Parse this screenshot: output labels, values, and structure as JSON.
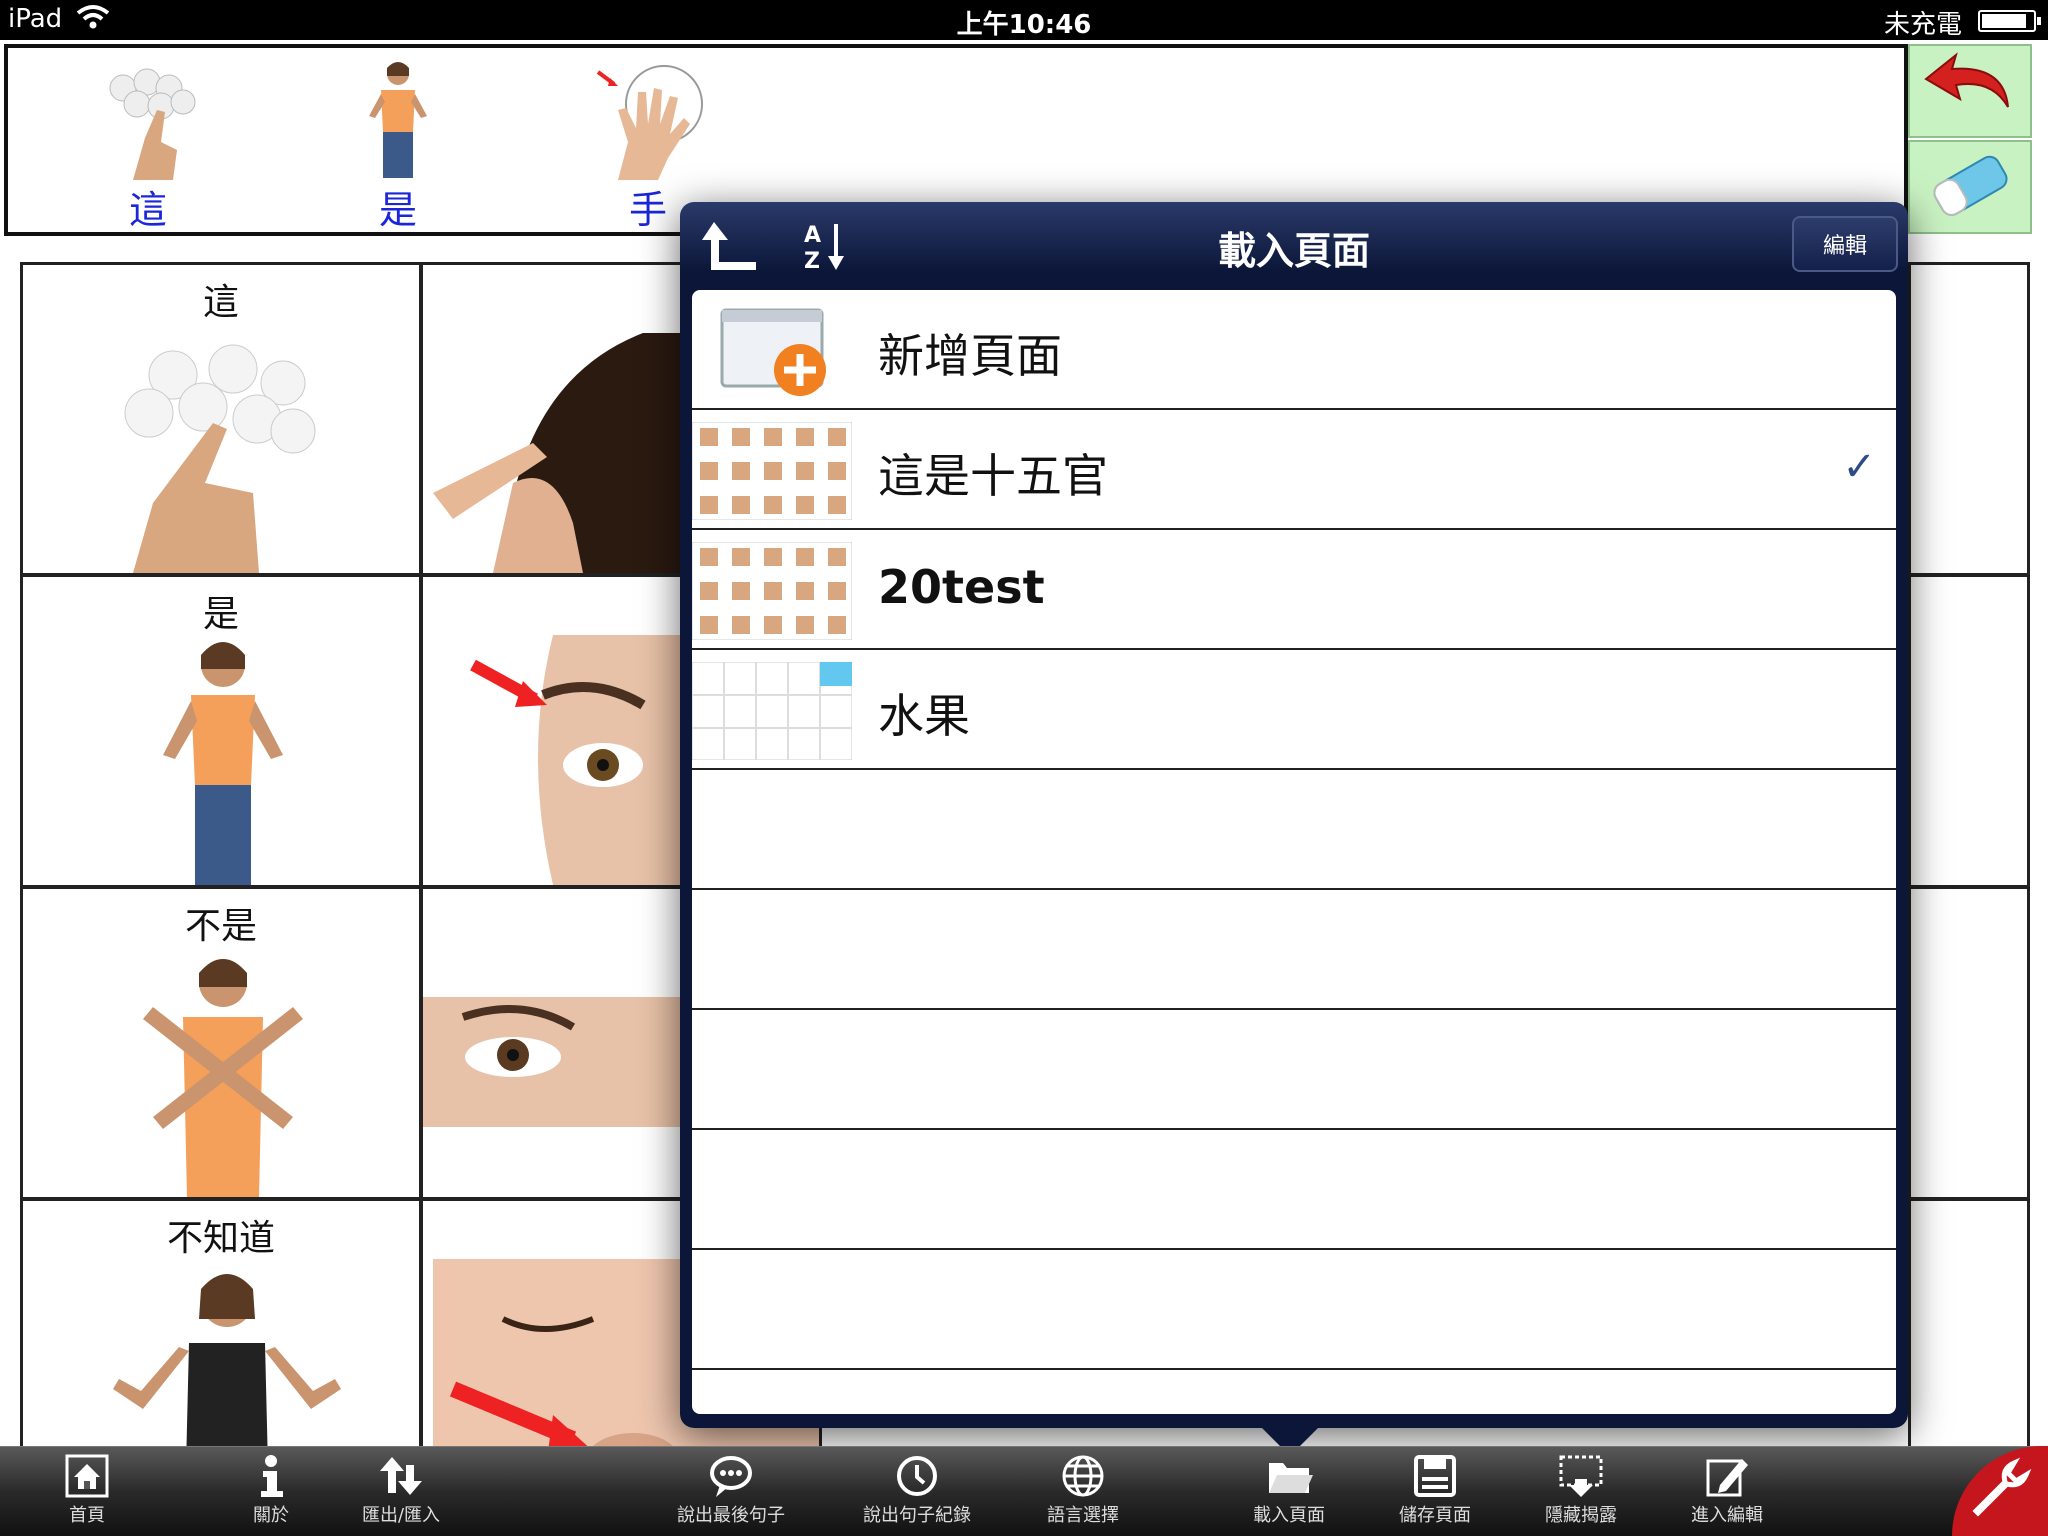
{
  "status_bar": {
    "carrier": "iPad",
    "time": "上午10:46",
    "charge": "未充電"
  },
  "sentence": [
    {
      "word": "這",
      "icon": "pointing-hand-icon"
    },
    {
      "word": "是",
      "icon": "woman-icon"
    },
    {
      "word": "手",
      "icon": "hand-icon"
    }
  ],
  "side_buttons": {
    "undo": "undo-arrow-icon",
    "clear": "eraser-icon"
  },
  "grid": {
    "col1": [
      "這",
      "是",
      "不是",
      "不知道"
    ],
    "col2": [
      "頭髮",
      "眉毛",
      "眼睛",
      "鼻子"
    ]
  },
  "popover": {
    "title": "載入頁面",
    "edit": "編輯",
    "sort_label": "A Z",
    "rows": [
      {
        "name": "新增頁面",
        "bold": false,
        "checked": false
      },
      {
        "name": "這是十五官",
        "bold": false,
        "checked": true
      },
      {
        "name": "20test",
        "bold": true,
        "checked": false
      },
      {
        "name": "水果",
        "bold": false,
        "checked": false
      }
    ],
    "check": "✓"
  },
  "toolbar": [
    {
      "label": "首頁",
      "icon": "home-icon"
    },
    {
      "label": "關於",
      "icon": "info-icon"
    },
    {
      "label": "匯出/匯入",
      "icon": "export-import-icon"
    },
    {
      "label": "說出最後句子",
      "icon": "speech-bubble-icon"
    },
    {
      "label": "說出句子紀錄",
      "icon": "clock-icon"
    },
    {
      "label": "語言選擇",
      "icon": "globe-icon"
    },
    {
      "label": "載入頁面",
      "icon": "folder-icon"
    },
    {
      "label": "儲存頁面",
      "icon": "floppy-icon"
    },
    {
      "label": "隱藏揭露",
      "icon": "hide-reveal-icon"
    },
    {
      "label": "進入編輯",
      "icon": "edit-icon"
    }
  ],
  "colors": {
    "word_blue": "#1a26d9",
    "popover_navy": "#0b1638",
    "side_green": "#c9f2c2",
    "wrench_red": "#c5161d"
  }
}
